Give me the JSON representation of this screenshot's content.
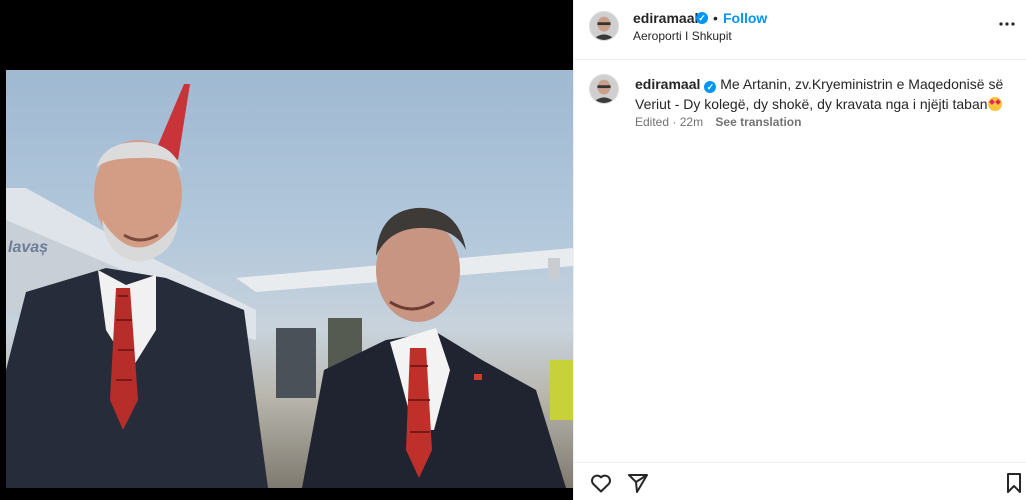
{
  "post": {
    "username": "ediramaal",
    "verified_mark": "✓",
    "separator": "•",
    "follow_label": "Follow",
    "location": "Aeroporti I Shkupit",
    "caption": "Me Artanin, zv.Kryeministrin e Maqedonisë së Veriut - Dy kolegë, dy shokë, dy kravata nga i njëjti taban",
    "edited_label": "Edited",
    "time_sep": "·",
    "time": "22m",
    "see_translation": "See translation"
  },
  "icons": {
    "more": "more-options-icon",
    "like": "heart-icon",
    "share": "paper-plane-icon",
    "save": "bookmark-icon",
    "caption_emoji": "star-struck-emoji"
  },
  "colors": {
    "accent": "#0095f6",
    "text": "#262626",
    "muted": "#737373",
    "tie": "#c0302b"
  }
}
